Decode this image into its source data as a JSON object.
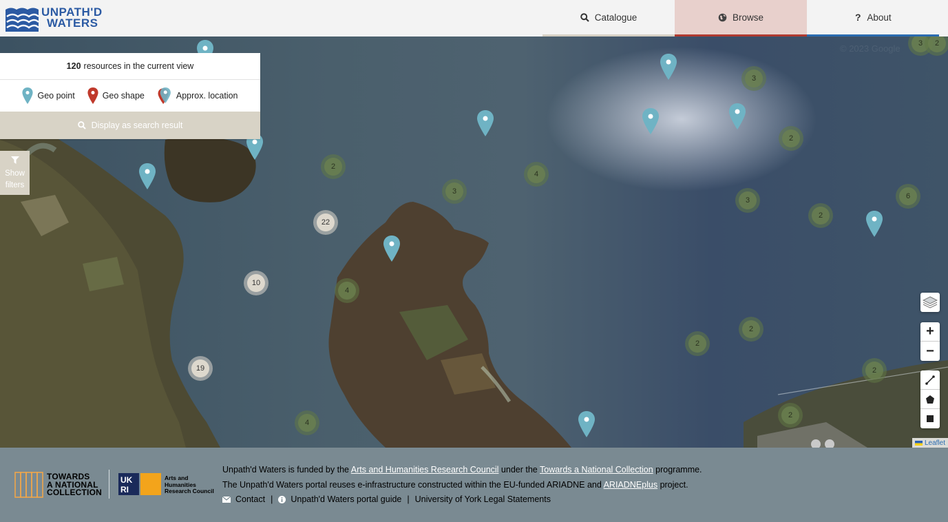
{
  "header": {
    "logo_line1": "UNPATH'D",
    "logo_line2": "WATERS",
    "nav": [
      {
        "label": "Catalogue",
        "icon": "search-icon"
      },
      {
        "label": "Browse",
        "icon": "globe-icon",
        "active": true
      },
      {
        "label": "About",
        "icon": "question-icon"
      }
    ]
  },
  "map": {
    "count": "120",
    "count_suffix": "resources in the current view",
    "legend": {
      "geo_point": "Geo point",
      "geo_shape": "Geo shape",
      "approx": "Approx. location"
    },
    "display_button": "Display as search result",
    "filters_line1": "Show",
    "filters_line2": "filters",
    "clusters": [
      "3",
      "3",
      "2",
      "2",
      "4",
      "3",
      "3",
      "2",
      "6",
      "22",
      "10",
      "4",
      "19",
      "2",
      "2",
      "2",
      "2",
      "4",
      "2"
    ],
    "attribution": "Leaflet",
    "watermark": "© 2023 Google",
    "colors": {
      "pin": "#6fb3c4",
      "geo_shape": "#c0392b",
      "browse_accent": "#b03a30",
      "about_accent": "#2b6cb0"
    }
  },
  "footer": {
    "tanc_line1": "TOWARDS",
    "tanc_line2": "A NATIONAL",
    "tanc_line3": "COLLECTION",
    "ukri_line1": "Arts and",
    "ukri_line2": "Humanities",
    "ukri_line3": "Research Council",
    "line1_a": "Unpath'd Waters is funded by the ",
    "line1_link1": "Arts and Humanities Research Council",
    "line1_b": " under the ",
    "line1_link2": "Towards a National Collection",
    "line1_c": " programme.",
    "line2_a": "The Unpath'd Waters portal reuses e-infrastructure constructed within the EU-funded ARIADNE and ",
    "line2_link": "ARIADNEplus",
    "line2_b": " project.",
    "contact": "Contact",
    "sep": "|",
    "guide": "Unpath'd Waters portal guide",
    "legal": "University of York Legal Statements"
  }
}
